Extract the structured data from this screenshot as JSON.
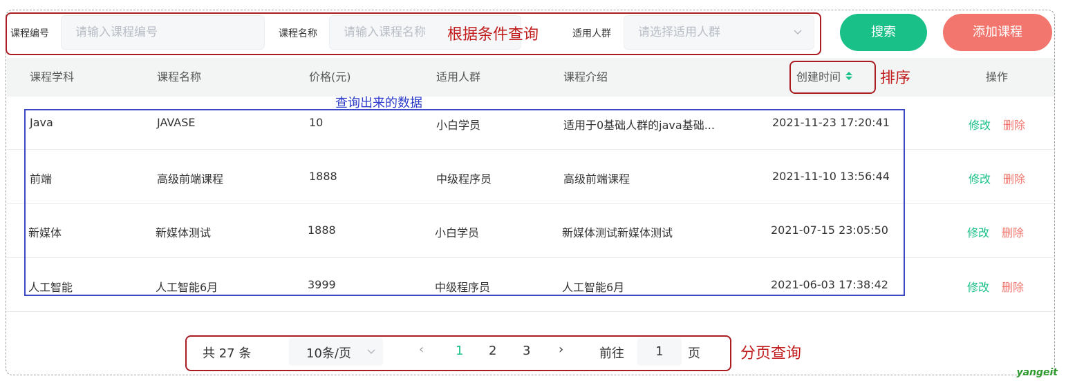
{
  "search": {
    "course_id_label": "课程编号",
    "course_id_placeholder": "请输入课程编号",
    "course_name_label": "课程名称",
    "course_name_placeholder": "请输入课程名称",
    "audience_label": "适用人群",
    "audience_placeholder": "请选择适用人群",
    "search_button": "搜索",
    "add_button": "添加课程"
  },
  "annotations": {
    "query_conditions": "根据条件查询",
    "sort": "排序",
    "query_data": "查询出来的数据",
    "pagination_query": "分页查询"
  },
  "table": {
    "headers": [
      "课程学科",
      "课程名称",
      "价格(元)",
      "适用人群",
      "课程介绍",
      "创建时间",
      "操作"
    ],
    "rows": [
      [
        "Java",
        "JAVASE",
        "10",
        "小白学员",
        "适用于0基础人群的java基础...",
        "2021-11-23 17:20:41"
      ],
      [
        "前端",
        "高级前端课程",
        "1888",
        "中级程序员",
        "高级前端课程",
        "2021-11-10 13:56:44"
      ],
      [
        "新媒体",
        "新媒体测试",
        "1888",
        "小白学员",
        "新媒体测试新媒体测试",
        "2021-07-15 23:05:50"
      ],
      [
        "人工智能",
        "人工智能6月",
        "3999",
        "中级程序员",
        "人工智能6月",
        "2021-06-03 17:38:42"
      ]
    ],
    "edit_label": "修改",
    "delete_label": "删除"
  },
  "pagination": {
    "total": "共 27 条",
    "page_size": "10条/页",
    "prev": "‹",
    "pages": [
      "1",
      "2",
      "3"
    ],
    "next": "›",
    "goto_label": "前往",
    "goto_value": "1",
    "page_suffix": "页"
  },
  "watermark": "yangeit",
  "colors": {
    "accent_green": "#19c088",
    "accent_red": "#f2766d",
    "annotation_red": "#a81c22",
    "annotation_blue": "#3b48c6"
  }
}
